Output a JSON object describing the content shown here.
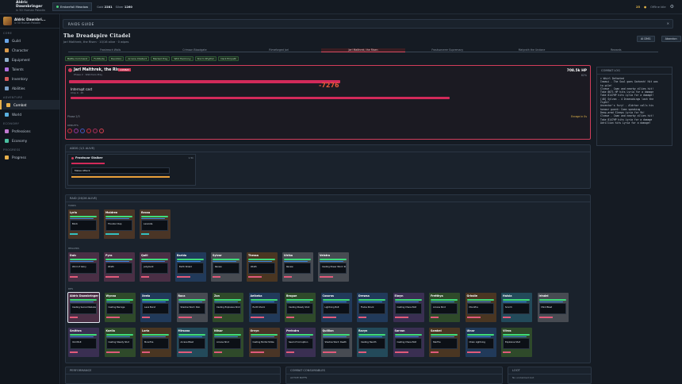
{
  "topbar": {
    "char_name": "Aldric Dawnbringer",
    "char_sub": "lv 50 Human Paladin",
    "zone": "Emberfall Meadow",
    "stat1_label": "Gold",
    "stat1": "2281",
    "stat2_label": "Silver",
    "stat2": "1260",
    "gold": "25",
    "status": "Offline Idle"
  },
  "sidebar": {
    "char_name": "Aldric Dawnbri...",
    "char_sub": "lv 50 Human Paladin",
    "sections": [
      {
        "title": "Core",
        "items": [
          {
            "label": "Guild",
            "color": "#6aa5e8"
          },
          {
            "label": "Character",
            "color": "#d99a4b"
          },
          {
            "label": "Equipment",
            "color": "#8fb0cc"
          },
          {
            "label": "Talents",
            "color": "#b070e0"
          },
          {
            "label": "Inventory",
            "color": "#d45a5a"
          },
          {
            "label": "Abilities",
            "color": "#7aa0c8"
          }
        ]
      },
      {
        "title": "Adventure",
        "items": [
          {
            "label": "Combat",
            "color": "#e7b04b",
            "active": true
          },
          {
            "label": "World",
            "color": "#5ab0e0"
          }
        ]
      },
      {
        "title": "Economy",
        "items": [
          {
            "label": "Professions",
            "color": "#c07ad0"
          },
          {
            "label": "Economy",
            "color": "#4ac0a0"
          }
        ]
      },
      {
        "title": "Progress",
        "items": [
          {
            "label": "Progress",
            "color": "#e7b04b"
          }
        ]
      }
    ]
  },
  "raid_guide": {
    "label": "RAIDS GUIDE",
    "title": "The Dreadspire Citadel",
    "subtitle": "Jarl Malthrek, the Risen · 10/16 alive · 0 wipes",
    "btn1": "AI DMG",
    "btn2": "Abandon",
    "stages": [
      "Frostreach Walls",
      "Crimson Bloodgate",
      "Rimeforged Jarl",
      "Jarl Malthrek, the Risen",
      "Frostsorcerer Supremacy",
      "Malyroth the Undone",
      "Rewards"
    ],
    "tags": [
      "Battle Command",
      "Fortitude",
      "Devotion",
      "Arcane Intellect",
      "Marked Prey",
      "Wild Harmony",
      "Storm Rhythm",
      "Dark Empath"
    ]
  },
  "boss": {
    "name": "Jarl Malthrek, the Risen",
    "badge": "COMBAT",
    "phase_sub": "Phase 2 · Watchers Prey",
    "hp": "708.5k HP",
    "hp_pct": "62%",
    "cast_label": "Interrupt cast",
    "cast_sub": "Chip 4 · 25",
    "damage": "-7276",
    "phase": "Phase 2/3",
    "enrage": "Enrage in 0s",
    "debuffs_label": "DEBUFFS"
  },
  "log": {
    "title": "COMBAT LOG",
    "lines": [
      "> Whirl Defeated",
      "Inmaui - The Soul goes Garkenh! Hit was",
      "to pile!",
      "Cleave - Caan and nearby allies hit!",
      "Take 8671 HP hits Lyria for a damage",
      "Take 8147HP hits Lyria for a damage!",
      "[48] Sylvan - 4 Draenwkings lash the",
      "fight!",
      "Ancestor's fury! - Aldrhor calls his",
      "honour guard: Caan speaking",
      "Deep-armd Sleeps Lyria for 9k!",
      "Cleave - Caan and nearby allies hit!",
      "Take 8147HP hits Lyria for a damage",
      "Adrillion hits Lyria for a damage!"
    ]
  },
  "adds": {
    "title": "ADDS (1/1 ALIVE)",
    "name": "Frostscar Stalker",
    "hp": "1.5k",
    "cast": "Melee Attack"
  },
  "raid": {
    "title": "RAID (26/26 ALIVE)",
    "tank_label": "TANKS",
    "heal_label": "HEALERS",
    "dps_label": "DPS",
    "tanks": [
      {
        "n": "Lyria",
        "c": "Block",
        "cls": "war"
      },
      {
        "n": "Maldren",
        "c": "Thunder Clap",
        "cls": "war"
      },
      {
        "n": "Rexxa",
        "c": "Lacerate",
        "cls": "war"
      }
    ],
    "healers": [
      {
        "n": "Dulc",
        "c": "Word of Glory",
        "cls": "pal"
      },
      {
        "n": "Pyra",
        "c": "Wrath",
        "cls": "pal"
      },
      {
        "n": "Quill",
        "c": "Judgment",
        "cls": "pal"
      },
      {
        "n": "Barida",
        "c": "Earth Shield",
        "cls": "sha"
      },
      {
        "n": "Sylvar",
        "c": "Renew",
        "cls": "pri"
      },
      {
        "n": "Thessa",
        "c": "Wrath",
        "cls": "dru"
      },
      {
        "n": "Ulrika",
        "c": "Renew",
        "cls": "pri"
      },
      {
        "n": "Velstra",
        "c": "Casting Power Word: Shi",
        "cls": "pri"
      }
    ],
    "dps1": [
      {
        "n": "Aldric Dawnbringer",
        "c": "Casting Sacred Rebuke",
        "cls": "pal"
      },
      {
        "n": "Wynna",
        "c": "Casting Barrage",
        "cls": "hun"
      },
      {
        "n": "Xeela",
        "c": "Lava Burst",
        "cls": "sha"
      },
      {
        "n": "Raca",
        "c": "Shadow Word: Pain",
        "cls": "pri"
      },
      {
        "n": "Zan",
        "c": "Casting Explosive Shot",
        "cls": "hun"
      },
      {
        "n": "Aelbeka",
        "c": "Earth Shock",
        "cls": "sha"
      },
      {
        "n": "Brogue",
        "c": "Casting Steady Shot",
        "cls": "hun"
      },
      {
        "n": "Cassros",
        "c": "Lightning Bolt",
        "cls": "sha"
      },
      {
        "n": "Drewsa",
        "c": "Flame Shock",
        "cls": "sha"
      },
      {
        "n": "Elwyn",
        "c": "Casting Chaos Bolt",
        "cls": "wlk"
      },
      {
        "n": "Fretthya",
        "c": "Arcane Shot",
        "cls": "hun"
      },
      {
        "n": "Grindle",
        "c": "Moonfire",
        "cls": "dru"
      },
      {
        "n": "Halsia",
        "c": "Scorch",
        "cls": "mag"
      },
      {
        "n": "Irindel",
        "c": "Mind Blast",
        "cls": "pri"
      }
    ],
    "dps2": [
      {
        "n": "Smithra",
        "c": "Void Bolt",
        "cls": "wlk"
      },
      {
        "n": "Kaelia",
        "c": "Casting Steady Shot",
        "cls": "hun"
      },
      {
        "n": "Lorla",
        "c": "Moonfire",
        "cls": "dru"
      },
      {
        "n": "Mirsana",
        "c": "Arcane Blast",
        "cls": "mag"
      },
      {
        "n": "Nilsar",
        "c": "Arcane Shot",
        "cls": "hun"
      },
      {
        "n": "Orvyn",
        "c": "Casting Mortal Strike",
        "cls": "war"
      },
      {
        "n": "Perindra",
        "c": "Seed of Corruption",
        "cls": "wlk"
      },
      {
        "n": "Quillian",
        "c": "Shadow Word: Death",
        "cls": "pri"
      },
      {
        "n": "Ravyn",
        "c": "Casting Hearth",
        "cls": "mag"
      },
      {
        "n": "Sorvan",
        "c": "Casting Chaos Bolt",
        "cls": "wlk"
      },
      {
        "n": "Sambel",
        "c": "Starfire",
        "cls": "dru"
      },
      {
        "n": "Ulnar",
        "c": "Chain Lightning",
        "cls": "sha"
      },
      {
        "n": "Vilros",
        "c": "Explosive Shot",
        "cls": "hun"
      }
    ]
  },
  "bottom": {
    "perf": "PERFORMANCE",
    "cons": "COMBAT CONSUMABLES",
    "cons_sub": "ACTIVE BUFFS",
    "loot": "LOOT",
    "loot_sub": "No unclaimed loot"
  }
}
